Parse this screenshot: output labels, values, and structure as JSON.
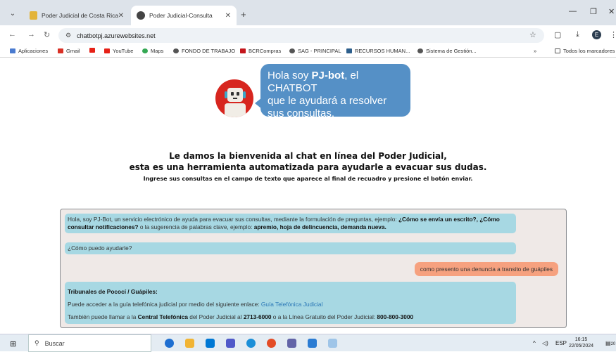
{
  "browser": {
    "tabs": [
      {
        "title": "Poder Judicial de Costa Rica - I",
        "active": false
      },
      {
        "title": "Poder Judicial-Consulta",
        "active": true
      }
    ],
    "url": "chatbotpj.azurewebsites.net",
    "bookmarks": [
      "Aplicaciones",
      "Gmail",
      "",
      "YouTube",
      "Maps",
      "FONDO DE TRABAJO",
      "BCRCompras",
      "SAG - PRINCIPAL",
      "RECURSOS HUMAN...",
      "Sistema de Gestión..."
    ],
    "bookmarks_more": "»",
    "all_bookmarks": "Todos los marcadores",
    "profile_initial": "E"
  },
  "header": {
    "bubble_line1_pre": "Hola soy ",
    "bubble_name": "PJ-bot",
    "bubble_line1_post": ", el CHATBOT",
    "bubble_line2": "que le ayudará a resolver",
    "bubble_line3": "sus consultas.",
    "avatar_label": "PJ-bot"
  },
  "welcome": {
    "line1": "Le damos la bienvenida al chat en línea del Poder Judicial,",
    "line2": "esta es una herramienta automatizada para ayudarle a evacuar sus dudas.",
    "instruction": "Ingrese sus consultas en el campo de texto que aparece al final de recuadro y presione el botón enviar."
  },
  "chat": {
    "intro_pre": "Hola, soy PJ-Bot, un servicio electrónico de ayuda para evacuar sus consultas, mediante la formulación de preguntas, ejemplo: ",
    "intro_bold": "¿Cómo se envía un escrito?, ¿Cómo consultar notificaciones?",
    "intro_mid": " o la sugerencia de palabras clave, ejemplo: ",
    "intro_keywords": "apremio, hoja de delincuencia, demanda nueva.",
    "ask": "¿Cómo puedo ayudarle?",
    "user_msg": "como presento una denuncia a transito de guápiles",
    "reply_title": "Tribunales de Pococí / Guápiles:",
    "reply_line1_pre": "Puede acceder a la guía telefónica judicial por medio del siguiente enlace: ",
    "reply_link": "Guía Telefónica Judicial",
    "reply_line2_pre": "También puede llamar a la ",
    "reply_line2_bold1": "Central Telefónica",
    "reply_line2_mid": " del Poder Judicial al ",
    "reply_line2_num1": "2713-6000",
    "reply_line2_mid2": " o a la Línea Gratuito del Poder Judicial: ",
    "reply_line2_num2": "800-800-3000"
  },
  "taskbar": {
    "search_label": "Buscar",
    "lang": "ESP",
    "time": "16:15",
    "date": "22/05/2024",
    "notif_count": "20"
  },
  "colors": {
    "bubble": "#5590c6",
    "bot_msg": "#a7d8e3",
    "user_msg": "#f6a17f",
    "avatar": "#d7261f"
  }
}
